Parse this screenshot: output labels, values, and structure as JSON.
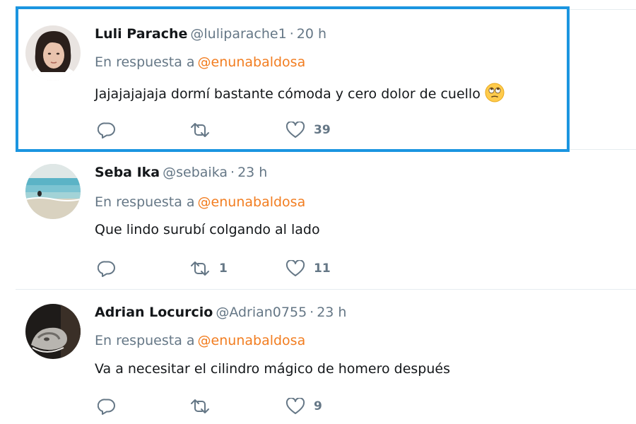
{
  "tweets": [
    {
      "name": "Luli Parache",
      "handle": "@luliparache1",
      "separator": "·",
      "time": "20 h",
      "reply_prefix": "En respuesta a",
      "reply_to": "@enunabaldosa",
      "text": "Jajajajajaja dormí bastante cómoda y cero dolor de cuello",
      "emoji": "rolling-eyes-emoji",
      "replies": "",
      "retweets": "",
      "likes": "39",
      "highlighted": true
    },
    {
      "name": "Seba Ika",
      "handle": "@sebaika",
      "separator": "·",
      "time": "23 h",
      "reply_prefix": "En respuesta a",
      "reply_to": "@enunabaldosa",
      "text": "Que lindo surubí colgando al lado",
      "replies": "",
      "retweets": "1",
      "likes": "11",
      "highlighted": false
    },
    {
      "name": "Adrian Locurcio",
      "handle": "@Adrian0755",
      "separator": "·",
      "time": "23 h",
      "reply_prefix": "En respuesta a",
      "reply_to": "@enunabaldosa",
      "text": "Va a necesitar el cilindro mágico de homero después",
      "replies": "",
      "retweets": "",
      "likes": "9",
      "highlighted": false
    }
  ],
  "colors": {
    "highlight_border": "#1b95e0",
    "mention": "#f27d20",
    "secondary_text": "#657786",
    "primary_text": "#14171a",
    "divider": "#e6ecf0"
  },
  "icons": {
    "reply": "reply-icon",
    "retweet": "retweet-icon",
    "like": "heart-icon"
  }
}
